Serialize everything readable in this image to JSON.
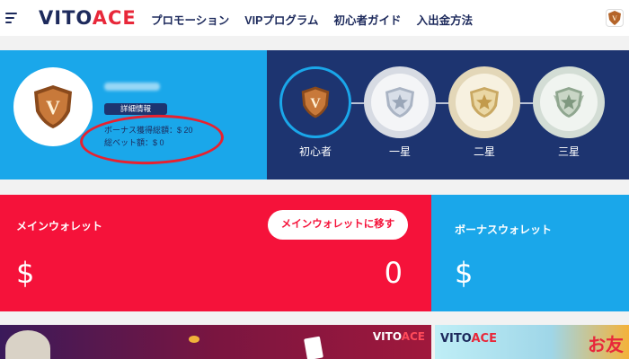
{
  "header": {
    "logo_main": "VITO",
    "logo_accent": "ACE",
    "nav": [
      "プロモーション",
      "VIPプログラム",
      "初心者ガイド",
      "入出金方法"
    ]
  },
  "profile": {
    "detail_button": "詳細情報",
    "bonus_total": "ボーナス獲得総額：$ 20",
    "bet_total": "総ベット額：$ 0"
  },
  "ranks": {
    "current_index": 0,
    "items": [
      {
        "label": "初心者",
        "icon": "bronze-v-shield-icon"
      },
      {
        "label": "一星",
        "icon": "silver-star-shield-icon"
      },
      {
        "label": "二星",
        "icon": "gold-star-shield-icon"
      },
      {
        "label": "三星",
        "icon": "green-star-shield-icon"
      }
    ]
  },
  "main_wallet": {
    "label": "メインウォレット",
    "move_button": "メインウォレットに移す",
    "currency": "$",
    "amount": "0"
  },
  "bonus_wallet": {
    "label": "ボーナスウォレット",
    "currency": "$"
  },
  "banners": {
    "banner1_logo_main": "VITO",
    "banner1_logo_accent": "ACE",
    "banner2_logo_main": "VITO",
    "banner2_logo_accent": "ACE",
    "banner2_text": "お友"
  },
  "colors": {
    "brand_navy": "#1d2a5c",
    "brand_red": "#e8283a",
    "sky_blue": "#1aa7ea",
    "wallet_red": "#f5123a",
    "rank_panel": "#1d3470"
  }
}
